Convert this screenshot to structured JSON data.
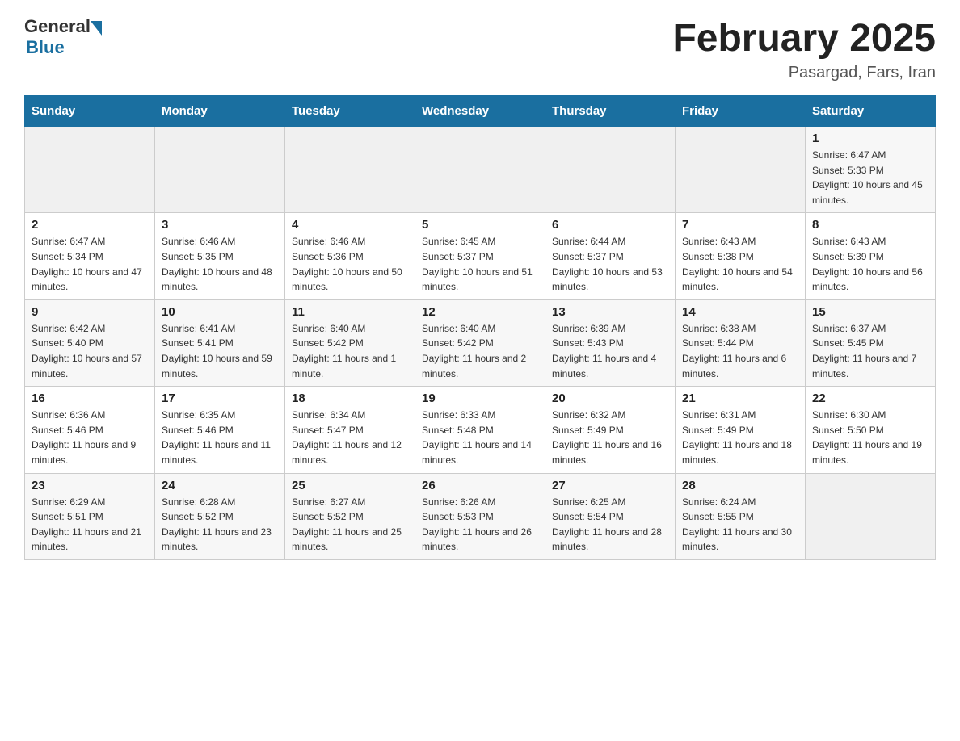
{
  "header": {
    "logo_general": "General",
    "logo_blue": "Blue",
    "title": "February 2025",
    "subtitle": "Pasargad, Fars, Iran"
  },
  "weekdays": [
    "Sunday",
    "Monday",
    "Tuesday",
    "Wednesday",
    "Thursday",
    "Friday",
    "Saturday"
  ],
  "weeks": [
    [
      {
        "day": "",
        "info": ""
      },
      {
        "day": "",
        "info": ""
      },
      {
        "day": "",
        "info": ""
      },
      {
        "day": "",
        "info": ""
      },
      {
        "day": "",
        "info": ""
      },
      {
        "day": "",
        "info": ""
      },
      {
        "day": "1",
        "info": "Sunrise: 6:47 AM\nSunset: 5:33 PM\nDaylight: 10 hours and 45 minutes."
      }
    ],
    [
      {
        "day": "2",
        "info": "Sunrise: 6:47 AM\nSunset: 5:34 PM\nDaylight: 10 hours and 47 minutes."
      },
      {
        "day": "3",
        "info": "Sunrise: 6:46 AM\nSunset: 5:35 PM\nDaylight: 10 hours and 48 minutes."
      },
      {
        "day": "4",
        "info": "Sunrise: 6:46 AM\nSunset: 5:36 PM\nDaylight: 10 hours and 50 minutes."
      },
      {
        "day": "5",
        "info": "Sunrise: 6:45 AM\nSunset: 5:37 PM\nDaylight: 10 hours and 51 minutes."
      },
      {
        "day": "6",
        "info": "Sunrise: 6:44 AM\nSunset: 5:37 PM\nDaylight: 10 hours and 53 minutes."
      },
      {
        "day": "7",
        "info": "Sunrise: 6:43 AM\nSunset: 5:38 PM\nDaylight: 10 hours and 54 minutes."
      },
      {
        "day": "8",
        "info": "Sunrise: 6:43 AM\nSunset: 5:39 PM\nDaylight: 10 hours and 56 minutes."
      }
    ],
    [
      {
        "day": "9",
        "info": "Sunrise: 6:42 AM\nSunset: 5:40 PM\nDaylight: 10 hours and 57 minutes."
      },
      {
        "day": "10",
        "info": "Sunrise: 6:41 AM\nSunset: 5:41 PM\nDaylight: 10 hours and 59 minutes."
      },
      {
        "day": "11",
        "info": "Sunrise: 6:40 AM\nSunset: 5:42 PM\nDaylight: 11 hours and 1 minute."
      },
      {
        "day": "12",
        "info": "Sunrise: 6:40 AM\nSunset: 5:42 PM\nDaylight: 11 hours and 2 minutes."
      },
      {
        "day": "13",
        "info": "Sunrise: 6:39 AM\nSunset: 5:43 PM\nDaylight: 11 hours and 4 minutes."
      },
      {
        "day": "14",
        "info": "Sunrise: 6:38 AM\nSunset: 5:44 PM\nDaylight: 11 hours and 6 minutes."
      },
      {
        "day": "15",
        "info": "Sunrise: 6:37 AM\nSunset: 5:45 PM\nDaylight: 11 hours and 7 minutes."
      }
    ],
    [
      {
        "day": "16",
        "info": "Sunrise: 6:36 AM\nSunset: 5:46 PM\nDaylight: 11 hours and 9 minutes."
      },
      {
        "day": "17",
        "info": "Sunrise: 6:35 AM\nSunset: 5:46 PM\nDaylight: 11 hours and 11 minutes."
      },
      {
        "day": "18",
        "info": "Sunrise: 6:34 AM\nSunset: 5:47 PM\nDaylight: 11 hours and 12 minutes."
      },
      {
        "day": "19",
        "info": "Sunrise: 6:33 AM\nSunset: 5:48 PM\nDaylight: 11 hours and 14 minutes."
      },
      {
        "day": "20",
        "info": "Sunrise: 6:32 AM\nSunset: 5:49 PM\nDaylight: 11 hours and 16 minutes."
      },
      {
        "day": "21",
        "info": "Sunrise: 6:31 AM\nSunset: 5:49 PM\nDaylight: 11 hours and 18 minutes."
      },
      {
        "day": "22",
        "info": "Sunrise: 6:30 AM\nSunset: 5:50 PM\nDaylight: 11 hours and 19 minutes."
      }
    ],
    [
      {
        "day": "23",
        "info": "Sunrise: 6:29 AM\nSunset: 5:51 PM\nDaylight: 11 hours and 21 minutes."
      },
      {
        "day": "24",
        "info": "Sunrise: 6:28 AM\nSunset: 5:52 PM\nDaylight: 11 hours and 23 minutes."
      },
      {
        "day": "25",
        "info": "Sunrise: 6:27 AM\nSunset: 5:52 PM\nDaylight: 11 hours and 25 minutes."
      },
      {
        "day": "26",
        "info": "Sunrise: 6:26 AM\nSunset: 5:53 PM\nDaylight: 11 hours and 26 minutes."
      },
      {
        "day": "27",
        "info": "Sunrise: 6:25 AM\nSunset: 5:54 PM\nDaylight: 11 hours and 28 minutes."
      },
      {
        "day": "28",
        "info": "Sunrise: 6:24 AM\nSunset: 5:55 PM\nDaylight: 11 hours and 30 minutes."
      },
      {
        "day": "",
        "info": ""
      }
    ]
  ]
}
